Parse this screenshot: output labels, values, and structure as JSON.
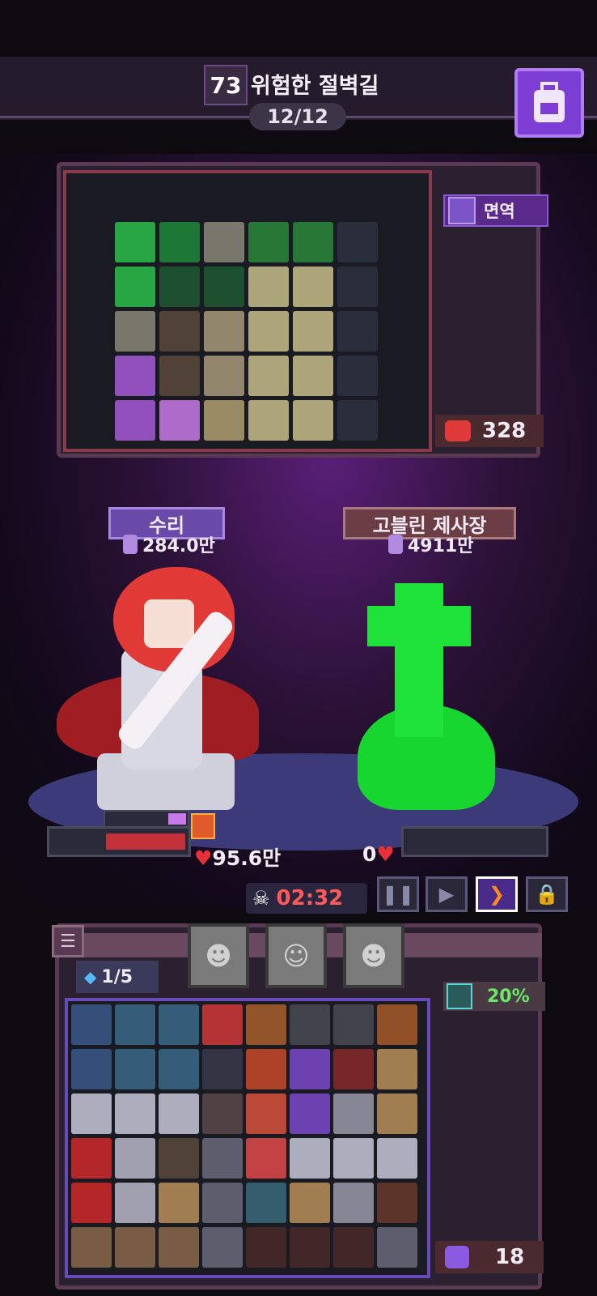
{
  "stage": {
    "number": "73",
    "title": "위험한 절벽길",
    "wave": "12/12"
  },
  "enemy_panel": {
    "immune_label": "면역",
    "threat_value": "328"
  },
  "hero": {
    "name": "수리",
    "power": "284.0만",
    "hp": "95.6만"
  },
  "enemy": {
    "name": "고블린 제사장",
    "power": "4911만",
    "hp": "0"
  },
  "battle": {
    "timer": "02:32",
    "controls": [
      "pause",
      "play",
      "fast-forward",
      "lock"
    ]
  },
  "player_panel": {
    "gems": "/5",
    "gem_prefix": "1",
    "crit_rate": "20%",
    "slot_count": "18"
  },
  "icons": [
    "backpack-icon",
    "skull-icon",
    "heart-icon",
    "sword-icon",
    "gem-icon",
    "menu-icon"
  ]
}
